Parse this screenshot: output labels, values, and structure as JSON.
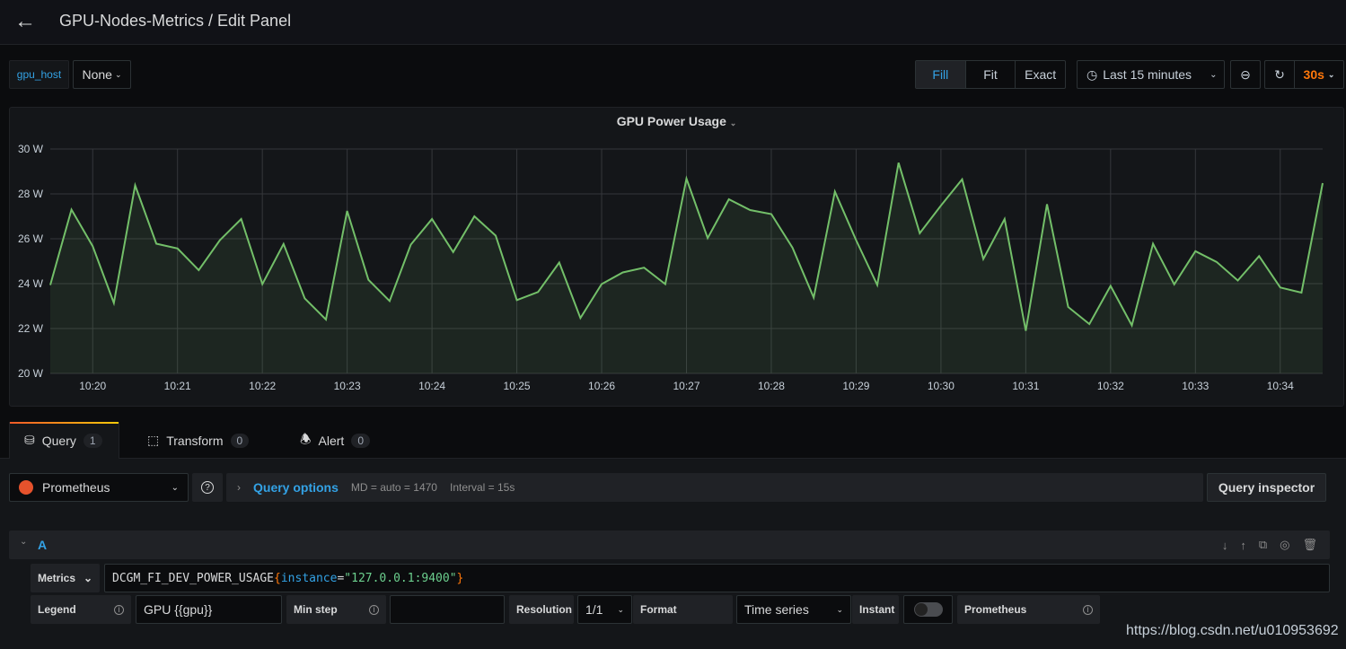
{
  "header": {
    "title": "GPU-Nodes-Metrics / Edit Panel"
  },
  "toolbar": {
    "variable_label": "gpu_host",
    "variable_value": "None",
    "modes": [
      "Fill",
      "Fit",
      "Exact"
    ],
    "active_mode": "Fill",
    "time_range": "Last 15 minutes",
    "refresh_interval": "30s",
    "refresh_color": "#ff780a"
  },
  "panel": {
    "title": "GPU Power Usage"
  },
  "chart_data": {
    "type": "area",
    "title": "GPU Power Usage",
    "line_color": "#73bf69",
    "ylim": [
      20,
      30
    ],
    "y_ticks": [
      "20 W",
      "22 W",
      "24 W",
      "26 W",
      "28 W",
      "30 W"
    ],
    "x_ticks": [
      "10:20",
      "10:21",
      "10:22",
      "10:23",
      "10:24",
      "10:25",
      "10:26",
      "10:27",
      "10:28",
      "10:29",
      "10:30",
      "10:31",
      "10:32",
      "10:33",
      "10:34"
    ],
    "x_start": "10:19:30",
    "x_step_seconds": 15,
    "grid": true,
    "values": [
      23.94,
      27.3,
      25.67,
      23.14,
      28.38,
      25.78,
      25.57,
      24.6,
      25.94,
      26.88,
      23.98,
      25.77,
      23.34,
      22.4,
      27.24,
      24.17,
      23.23,
      25.74,
      26.88,
      25.41,
      27.0,
      26.14,
      23.27,
      23.63,
      24.94,
      22.47,
      23.98,
      24.5,
      24.71,
      23.98,
      28.68,
      26.03,
      27.76,
      27.28,
      27.1,
      25.6,
      23.38,
      28.1,
      25.94,
      23.94,
      29.39,
      26.25,
      27.48,
      28.65,
      25.1,
      26.88,
      21.9,
      27.54,
      22.96,
      22.2,
      23.9,
      22.14,
      25.78,
      23.97,
      25.45,
      24.97,
      24.14,
      25.23,
      23.83,
      23.6,
      28.48
    ]
  },
  "tabs": [
    {
      "label": "Query",
      "count": "1"
    },
    {
      "label": "Transform",
      "count": "0"
    },
    {
      "label": "Alert",
      "count": "0"
    }
  ],
  "query": {
    "datasource": "Prometheus",
    "options_label": "Query options",
    "md": "MD = auto = 1470",
    "interval": "Interval = 15s",
    "inspector": "Query inspector",
    "ref": "A",
    "metrics_label": "Metrics",
    "expr": {
      "metric": "DCGM_FI_DEV_POWER_USAGE",
      "open": "{",
      "key": "instance",
      "eq": "=",
      "value": "\"127.0.0.1:9400\"",
      "close": "}"
    },
    "legend_label": "Legend",
    "legend_value": "GPU {{gpu}}",
    "minstep_label": "Min step",
    "minstep_value": "",
    "resolution_label": "Resolution",
    "resolution_value": "1/1",
    "format_label": "Format",
    "format_value": "Time series",
    "instant_label": "Instant",
    "instant_on": false,
    "prom_label": "Prometheus"
  },
  "watermark": "https://blog.csdn.net/u010953692"
}
